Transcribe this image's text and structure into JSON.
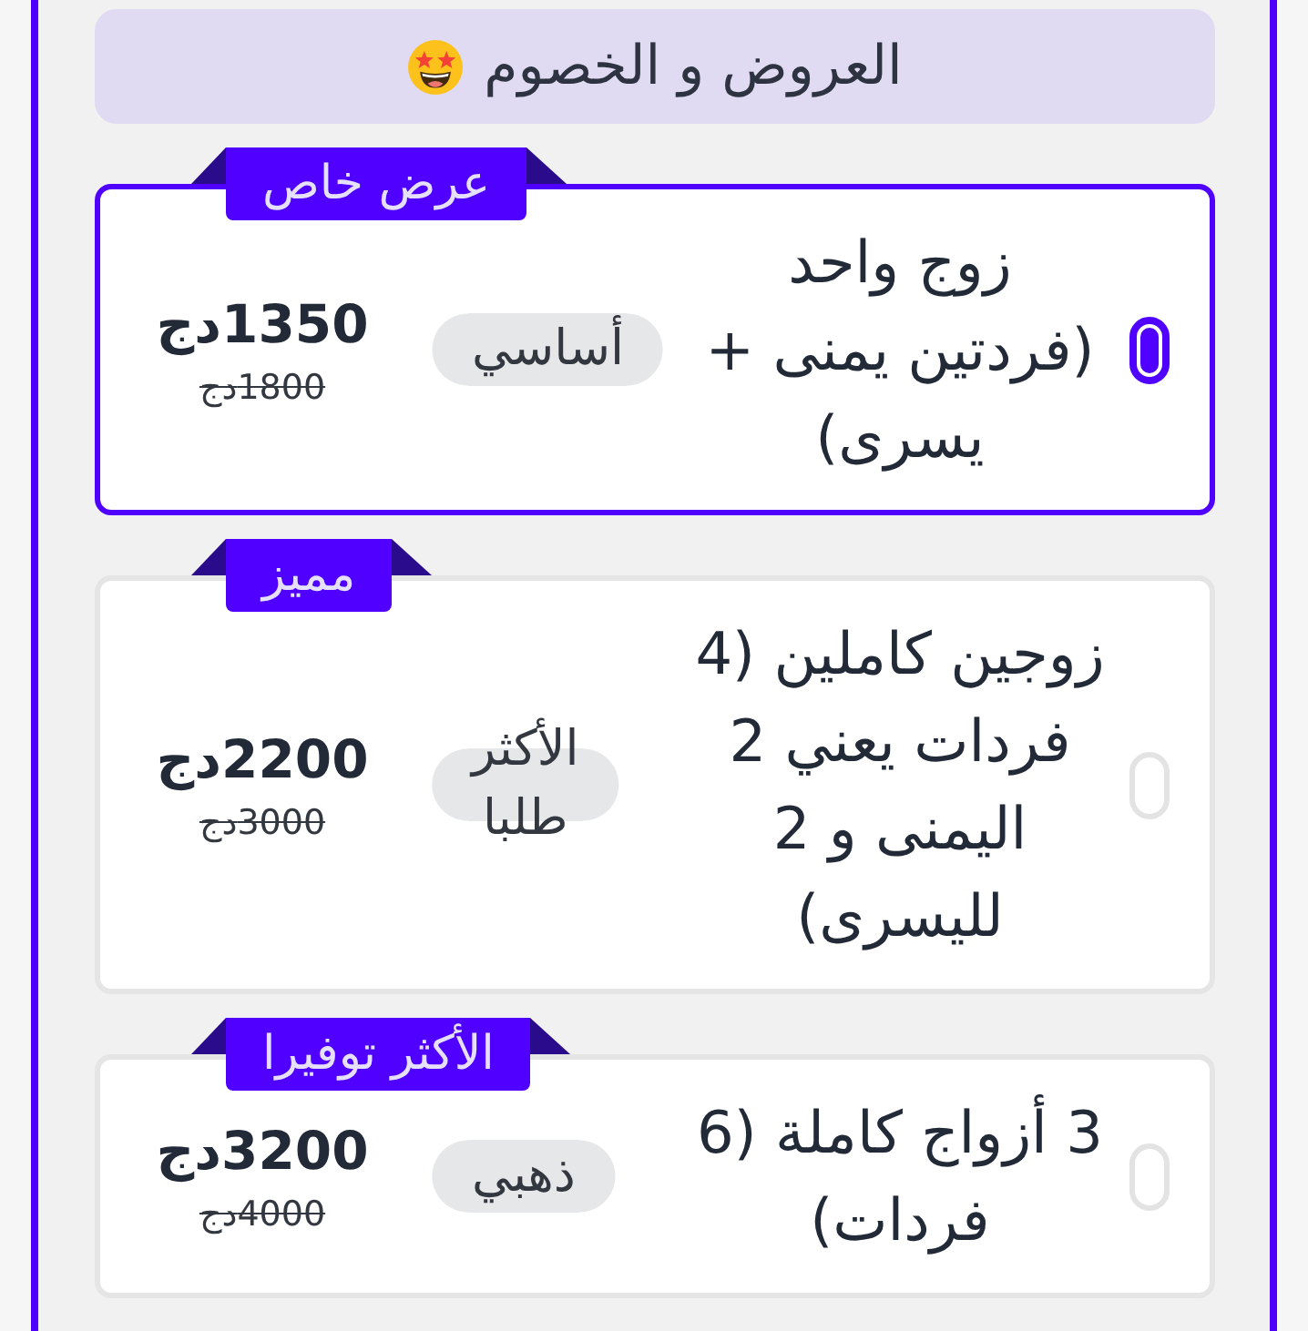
{
  "header": {
    "title": "العروض و الخصوم"
  },
  "offers": [
    {
      "ribbon": "عرض خاص",
      "selected": true,
      "title": "زوج واحد (فردتين يمنى + يسرى)",
      "tag": "أساسي",
      "price": "1350دج",
      "old_price": "1800دج"
    },
    {
      "ribbon": "مميز",
      "selected": false,
      "title": "زوجين كاملين (4 فردات يعني 2 اليمنى و 2 لليسرى)",
      "tag": "الأكثر طلبا",
      "price": "2200دج",
      "old_price": "3000دج"
    },
    {
      "ribbon": "الأكثر توفيرا",
      "selected": false,
      "title": "3 أزواج كاملة (6 فردات)",
      "tag": "ذهبي",
      "price": "3200دج",
      "old_price": "4000دج"
    }
  ]
}
